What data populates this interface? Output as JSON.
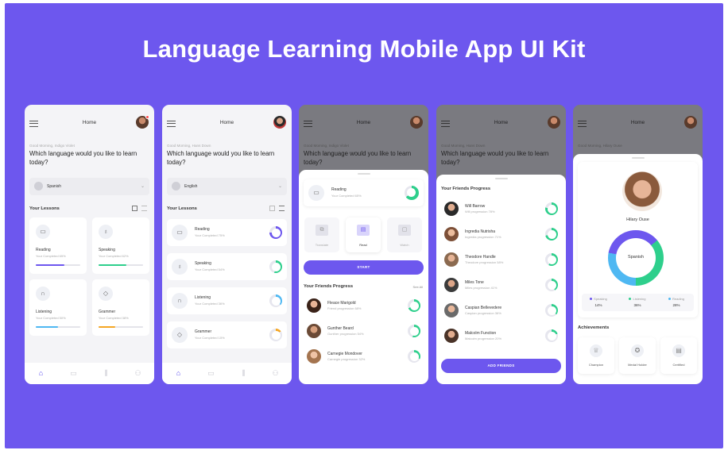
{
  "title": "Language Learning Mobile App UI Kit",
  "colors": {
    "background": "#6d57ee",
    "accent": "#6d57ee",
    "green": "#2ecf8c",
    "blue": "#4fb8f2",
    "orange": "#f5a623"
  },
  "screen1": {
    "header": "Home",
    "greeting": "Good Morning, Indigo Violet",
    "question": "Which language would you like to learn today?",
    "language": "Spanish",
    "lessons_title": "Your Lessons",
    "lessons": [
      {
        "name": "Reading",
        "sub": "Your Completed 65%",
        "progress": 0.65,
        "color": "#6d57ee",
        "icon": "book-icon"
      },
      {
        "name": "Speaking",
        "sub": "Your Completed 62%",
        "progress": 0.62,
        "color": "#2ecf8c",
        "icon": "microphone-icon"
      },
      {
        "name": "Listening",
        "sub": "Your Completed 50%",
        "progress": 0.5,
        "color": "#4fb8f2",
        "icon": "headphones-icon"
      },
      {
        "name": "Grammer",
        "sub": "Your Completed 38%",
        "progress": 0.38,
        "color": "#f5a623",
        "icon": "cube-icon"
      }
    ]
  },
  "screen2": {
    "header": "Home",
    "greeting": "Good Morning, Hans Down",
    "question": "Which language would you like to learn today?",
    "language": "English",
    "lessons_title": "Your Lessons",
    "lessons": [
      {
        "name": "Reading",
        "sub": "Your Completed 75%",
        "progress": 0.75,
        "color": "#6d57ee",
        "icon": "book-icon"
      },
      {
        "name": "Speaking",
        "sub": "Your Completed 54%",
        "progress": 0.54,
        "color": "#2ecf8c",
        "icon": "microphone-icon"
      },
      {
        "name": "Listening",
        "sub": "Your Completed 36%",
        "progress": 0.36,
        "color": "#4fb8f2",
        "icon": "headphones-icon"
      },
      {
        "name": "Grammer",
        "sub": "Your Completed 15%",
        "progress": 0.15,
        "color": "#f5a623",
        "icon": "cube-icon"
      }
    ]
  },
  "screen3": {
    "header": "Home",
    "greeting": "Good Morning, Indigo Violet",
    "question": "Which language would you like to learn today?",
    "lesson": {
      "name": "Reading",
      "sub": "Your Completed 65%"
    },
    "modes": [
      "Translate",
      "Read",
      "Watch"
    ],
    "start_label": "START",
    "friends_title": "Your Friends Progress",
    "see_all": "See All",
    "friends": [
      {
        "name": "Fleace Marigold",
        "sub": "Friend progression 68%",
        "progress": 0.68
      },
      {
        "name": "Gunther Beard",
        "sub": "Gunther progression 54%",
        "progress": 0.54
      },
      {
        "name": "Carnegie Mondover",
        "sub": "Carnegie progression 32%",
        "progress": 0.32
      }
    ]
  },
  "screen4": {
    "header": "Home",
    "greeting": "Good Morning, Hans Down",
    "question": "Which language would you like to learn today?",
    "friends_title": "Your Friends Progress",
    "friends": [
      {
        "name": "Will Barrow",
        "sub": "Will progression 78%",
        "progress": 0.78
      },
      {
        "name": "Ingredia Nutrisha",
        "sub": "Ingredia progression 71%",
        "progress": 0.71
      },
      {
        "name": "Theodore Handle",
        "sub": "Theodore progression 58%",
        "progress": 0.58
      },
      {
        "name": "Miles Tone",
        "sub": "Miles progression 41%",
        "progress": 0.41
      },
      {
        "name": "Caspian Bellevedere",
        "sub": "Caspian progression 36%",
        "progress": 0.36
      },
      {
        "name": "Malcolm Function",
        "sub": "Malcolm progression 20%",
        "progress": 0.2
      }
    ],
    "add_friends": "ADD FRIENDS"
  },
  "screen5": {
    "header": "Home",
    "greeting": "Good Morning, Hilary Ouse",
    "question": "Which language would you like to learn today?",
    "profile_name": "Hilary Ouse",
    "language": "Spanish",
    "legend": [
      {
        "label": "Speaking",
        "value": "14%",
        "color": "#6d57ee"
      },
      {
        "label": "Listening",
        "value": "36%",
        "color": "#2ecf8c"
      },
      {
        "label": "Reading",
        "value": "28%",
        "color": "#4fb8f2"
      }
    ],
    "achievements_title": "Achievements",
    "achievements": [
      {
        "label": "Champion",
        "icon": "trophy-icon"
      },
      {
        "label": "Medal Holder",
        "icon": "medal-icon"
      },
      {
        "label": "Certified",
        "icon": "certificate-icon"
      }
    ]
  }
}
